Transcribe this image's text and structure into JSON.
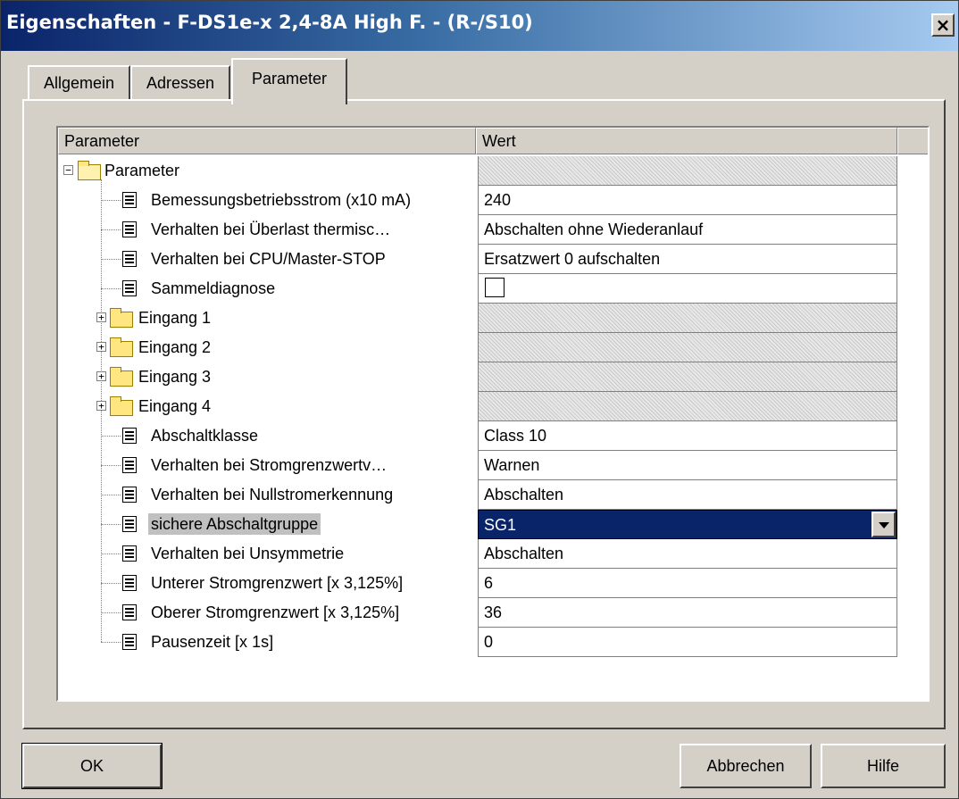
{
  "window": {
    "title": "Eigenschaften - F-DS1e-x 2,4-8A High F. - (R-/S10)",
    "close": "×"
  },
  "tabs": [
    {
      "label": "Allgemein"
    },
    {
      "label": "Adressen"
    },
    {
      "label": "Parameter"
    }
  ],
  "table": {
    "headers": {
      "parameter": "Parameter",
      "value": "Wert"
    },
    "root": {
      "label": "Parameter",
      "expander": "−"
    },
    "rows": [
      {
        "label": "Bemessungsbetriebsstrom (x10 mA)",
        "value": "240",
        "kind": "param"
      },
      {
        "label": "Verhalten bei Überlast thermisc…",
        "value": "Abschalten ohne Wiederanlauf",
        "kind": "param"
      },
      {
        "label": "Verhalten bei CPU/Master-STOP",
        "value": "Ersatzwert 0 aufschalten",
        "kind": "param"
      },
      {
        "label": "Sammeldiagnose",
        "value": "",
        "kind": "checkbox",
        "checked": false
      },
      {
        "label": "Eingang 1",
        "value": "",
        "kind": "folder",
        "expander": "+"
      },
      {
        "label": "Eingang 2",
        "value": "",
        "kind": "folder",
        "expander": "+"
      },
      {
        "label": "Eingang 3",
        "value": "",
        "kind": "folder",
        "expander": "+"
      },
      {
        "label": "Eingang 4",
        "value": "",
        "kind": "folder",
        "expander": "+"
      },
      {
        "label": "Abschaltklasse",
        "value": "Class 10",
        "kind": "param"
      },
      {
        "label": "Verhalten bei Stromgrenzwertv…",
        "value": "Warnen",
        "kind": "param"
      },
      {
        "label": "Verhalten bei Nullstromerkennung",
        "value": "Abschalten",
        "kind": "param"
      },
      {
        "label": "sichere Abschaltgruppe",
        "value": "SG1",
        "kind": "dropdown",
        "selected": true
      },
      {
        "label": "Verhalten bei Unsymmetrie",
        "value": "Abschalten",
        "kind": "param"
      },
      {
        "label": "Unterer Stromgrenzwert [x 3,125%]",
        "value": "6",
        "kind": "param"
      },
      {
        "label": "Oberer Stromgrenzwert [x 3,125%]",
        "value": "36",
        "kind": "param"
      },
      {
        "label": "Pausenzeit [x 1s]",
        "value": "0",
        "kind": "param"
      }
    ]
  },
  "buttons": {
    "ok": "OK",
    "cancel": "Abbrechen",
    "help": "Hilfe"
  },
  "colors": {
    "title_bar_start": "#0a246a",
    "title_bar_end": "#a6caf0",
    "selection": "#0a246a",
    "face": "#d4d0c8"
  }
}
